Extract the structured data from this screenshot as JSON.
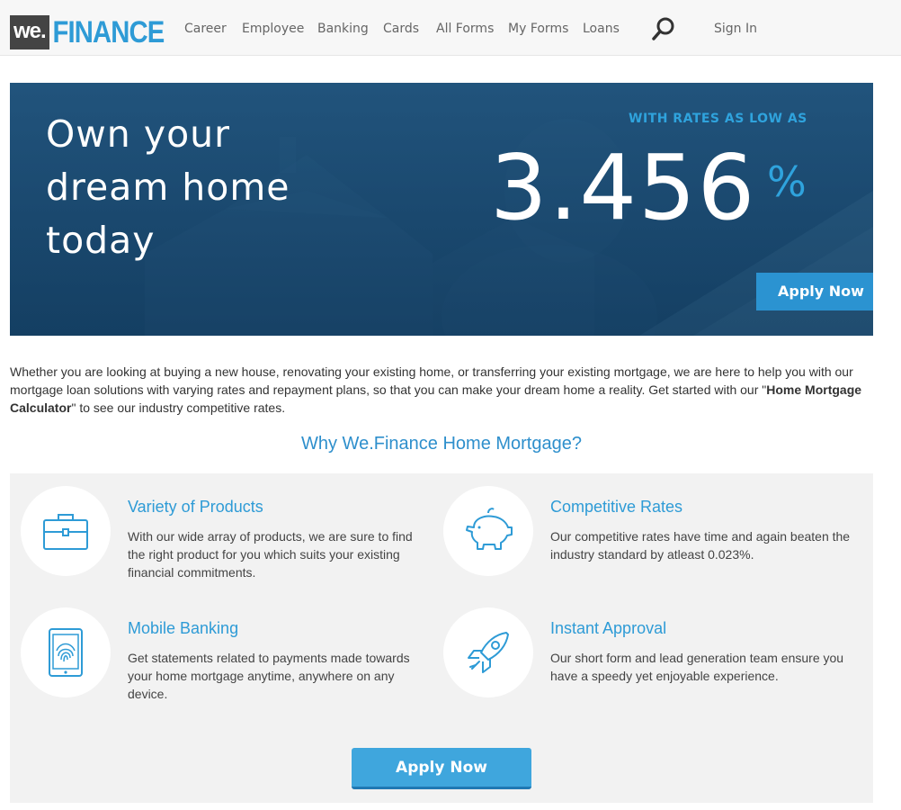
{
  "brand": {
    "prefix": "we.",
    "name": "FINANCE"
  },
  "nav": {
    "items": [
      "Career",
      "Employee",
      "Banking",
      "Cards",
      "All Forms",
      "My Forms",
      "Loans"
    ],
    "sign_in": "Sign In"
  },
  "hero": {
    "title_lines": [
      "Own your",
      "dream home",
      "today"
    ],
    "kicker": "WITH RATES AS LOW AS",
    "rate": "3.456",
    "rate_unit": "%",
    "apply_label": "Apply Now"
  },
  "intro": {
    "text_before": "Whether you are looking at buying a new house, renovating your existing home, or transferring your existing mortgage, we are here to help you with our mortgage loan solutions with varying rates and repayment plans, so that you can make your dream home a reality. Get started with our \"",
    "highlight": "Home Mortgage Calculator",
    "text_after": "\" to see our industry competitive rates."
  },
  "why": {
    "title": "Why We.Finance Home Mortgage?",
    "features": [
      {
        "icon": "briefcase-icon",
        "title": "Variety of Products",
        "desc": "With our wide array of products, we are sure to find the right product for you which suits your existing financial commitments."
      },
      {
        "icon": "piggy-bank-icon",
        "title": "Competitive Rates",
        "desc": "Our competitive rates have time and again beaten the industry standard by atleast 0.023%."
      },
      {
        "icon": "tablet-fingerprint-icon",
        "title": "Mobile Banking",
        "desc": "Get statements related to payments made towards your home mortgage anytime, anywhere on any device."
      },
      {
        "icon": "rocket-icon",
        "title": "Instant Approval",
        "desc": "Our short form and lead generation team ensure you have a speedy yet enjoyable experience."
      }
    ],
    "apply_label": "Apply Now"
  },
  "colors": {
    "accent": "#2e9bd6",
    "hero_bg": "#1a4a72",
    "button": "#3fa6dd"
  }
}
